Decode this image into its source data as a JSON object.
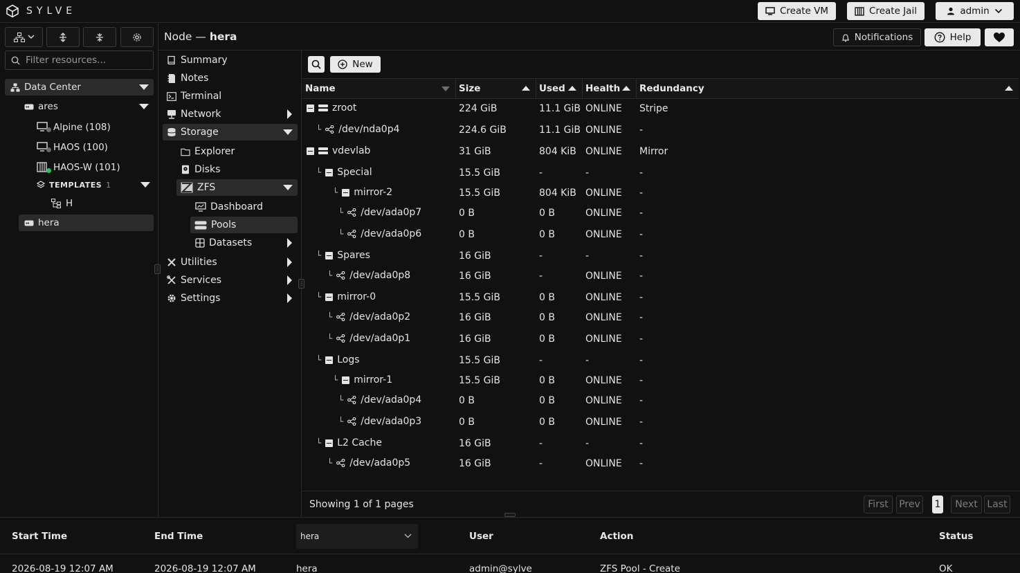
{
  "app": {
    "logo_text": "SYLVE"
  },
  "topbar": {
    "create_vm": "Create VM",
    "create_jail": "Create Jail",
    "user": "admin"
  },
  "left": {
    "filter_placeholder": "Filter resources...",
    "datacenter": "Data Center",
    "nodes": [
      {
        "label": "ares"
      },
      {
        "label": "hera"
      }
    ],
    "vms": [
      {
        "label": "Alpine (108)",
        "status": "stopped"
      },
      {
        "label": "HAOS (100)",
        "status": "stopped"
      },
      {
        "label": "HAOS-W (101)",
        "status": "running"
      }
    ],
    "templates": {
      "label": "TEMPLATES",
      "count": "1",
      "item": "H"
    }
  },
  "header": {
    "prefix": "Node —",
    "node": "hera",
    "notifications": "Notifications",
    "help": "Help"
  },
  "nav": {
    "summary": "Summary",
    "notes": "Notes",
    "terminal": "Terminal",
    "network": "Network",
    "storage": "Storage",
    "explorer": "Explorer",
    "disks": "Disks",
    "zfs": "ZFS",
    "dashboard": "Dashboard",
    "pools": "Pools",
    "datasets": "Datasets",
    "utilities": "Utilities",
    "services": "Services",
    "settings": "Settings"
  },
  "toolbar": {
    "new_label": "New"
  },
  "table": {
    "headers": {
      "name": "Name",
      "size": "Size",
      "used": "Used",
      "health": "Health",
      "redundancy": "Redundancy"
    },
    "rows": [
      {
        "name": "zroot",
        "size": "224 GiB",
        "used": "11.1 GiB",
        "health": "ONLINE",
        "redundancy": "Stripe"
      },
      {
        "name": "/dev/nda0p4",
        "size": "224.6 GiB",
        "used": "11.1 GiB",
        "health": "ONLINE",
        "redundancy": "-"
      },
      {
        "name": "vdevlab",
        "size": "31 GiB",
        "used": "804 KiB",
        "health": "ONLINE",
        "redundancy": "Mirror"
      },
      {
        "name": "Special",
        "size": "15.5 GiB",
        "used": "-",
        "health": "-",
        "redundancy": "-"
      },
      {
        "name": "mirror-2",
        "size": "15.5 GiB",
        "used": "804 KiB",
        "health": "ONLINE",
        "redundancy": "-"
      },
      {
        "name": "/dev/ada0p7",
        "size": "0 B",
        "used": "0 B",
        "health": "ONLINE",
        "redundancy": "-"
      },
      {
        "name": "/dev/ada0p6",
        "size": "0 B",
        "used": "0 B",
        "health": "ONLINE",
        "redundancy": "-"
      },
      {
        "name": "Spares",
        "size": "16 GiB",
        "used": "-",
        "health": "-",
        "redundancy": "-"
      },
      {
        "name": "/dev/ada0p8",
        "size": "16 GiB",
        "used": "-",
        "health": "ONLINE",
        "redundancy": "-"
      },
      {
        "name": "mirror-0",
        "size": "15.5 GiB",
        "used": "0 B",
        "health": "ONLINE",
        "redundancy": "-"
      },
      {
        "name": "/dev/ada0p2",
        "size": "16 GiB",
        "used": "0 B",
        "health": "ONLINE",
        "redundancy": "-"
      },
      {
        "name": "/dev/ada0p1",
        "size": "16 GiB",
        "used": "0 B",
        "health": "ONLINE",
        "redundancy": "-"
      },
      {
        "name": "Logs",
        "size": "15.5 GiB",
        "used": "-",
        "health": "-",
        "redundancy": "-"
      },
      {
        "name": "mirror-1",
        "size": "15.5 GiB",
        "used": "0 B",
        "health": "ONLINE",
        "redundancy": "-"
      },
      {
        "name": "/dev/ada0p4",
        "size": "0 B",
        "used": "0 B",
        "health": "ONLINE",
        "redundancy": "-"
      },
      {
        "name": "/dev/ada0p3",
        "size": "0 B",
        "used": "0 B",
        "health": "ONLINE",
        "redundancy": "-"
      },
      {
        "name": "L2 Cache",
        "size": "16 GiB",
        "used": "-",
        "health": "-",
        "redundancy": "-"
      },
      {
        "name": "/dev/ada0p5",
        "size": "16 GiB",
        "used": "-",
        "health": "ONLINE",
        "redundancy": "-"
      }
    ]
  },
  "pagination": {
    "summary": "Showing 1 of 1 pages",
    "first": "First",
    "prev": "Prev",
    "current": "1",
    "next": "Next",
    "last": "Last"
  },
  "log": {
    "headers": {
      "start": "Start Time",
      "end": "End Time",
      "user": "User",
      "action": "Action",
      "status": "Status"
    },
    "node_filter": "hera",
    "row": {
      "start": "2026-08-19 12:07 AM",
      "end": "2026-08-19 12:07 AM",
      "node": "hera",
      "user": "admin@sylve",
      "action": "ZFS Pool - Create",
      "status": "OK"
    }
  },
  "colors": {
    "online_green": "#22c55e",
    "stopped_gray": "#6b6b6b"
  }
}
